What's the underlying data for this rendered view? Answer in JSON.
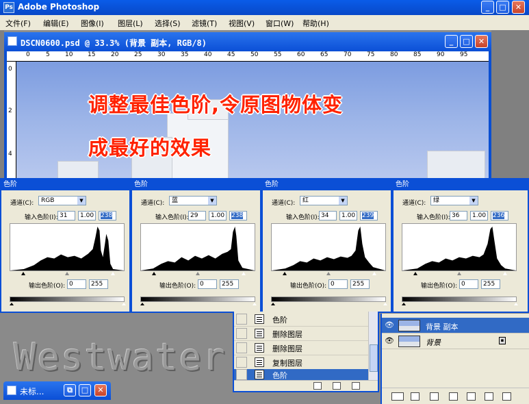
{
  "app": {
    "title": "Adobe Photoshop",
    "min": "_",
    "max": "□",
    "close": "✕"
  },
  "menu": [
    "文件(F)",
    "编辑(E)",
    "图像(I)",
    "图层(L)",
    "选择(S)",
    "滤镜(T)",
    "视图(V)",
    "窗口(W)",
    "帮助(H)"
  ],
  "document": {
    "title": "DSCN0600.psd @ 33.3% (背景 副本, RGB/8)",
    "ruler_top": [
      "0",
      "5",
      "10",
      "15",
      "20",
      "25",
      "30",
      "35",
      "40",
      "45",
      "50",
      "55",
      "60",
      "65",
      "70",
      "75",
      "80",
      "85",
      "90",
      "95"
    ],
    "ruler_left": [
      "0",
      "2",
      "4"
    ],
    "caption_line1": "调整最佳色阶,令原图物体变",
    "caption_line2": "成最好的效果"
  },
  "levels_dialogs": [
    {
      "title": "色阶",
      "channel_label": "通道(C):",
      "channel": "RGB",
      "input_label": "输入色阶(I):",
      "in_black": "31",
      "in_mid": "1.00",
      "in_white": "238",
      "output_label": "输出色阶(O):",
      "out_black": "0",
      "out_white": "255"
    },
    {
      "title": "色阶",
      "channel_label": "通道(C):",
      "channel": "蓝",
      "input_label": "输入色阶(I):",
      "in_black": "29",
      "in_mid": "1.00",
      "in_white": "238",
      "output_label": "输出色阶(O):",
      "out_black": "0",
      "out_white": "255"
    },
    {
      "title": "色阶",
      "channel_label": "通道(C):",
      "channel": "红",
      "input_label": "输入色阶(I):",
      "in_black": "34",
      "in_mid": "1.00",
      "in_white": "239",
      "output_label": "输出色阶(O):",
      "out_black": "0",
      "out_white": "255"
    },
    {
      "title": "色阶",
      "channel_label": "通道(C):",
      "channel": "绿",
      "input_label": "输入色阶(I):",
      "in_black": "36",
      "in_mid": "1.00",
      "in_white": "236",
      "output_label": "输出色阶(O):",
      "out_black": "0",
      "out_white": "255"
    }
  ],
  "watermark": "Westwater",
  "history": {
    "items": [
      {
        "label": "色阶",
        "active": false
      },
      {
        "label": "删除图层",
        "active": false
      },
      {
        "label": "删除图层",
        "active": false
      },
      {
        "label": "复制图层",
        "active": false
      },
      {
        "label": "色阶",
        "active": true
      }
    ]
  },
  "layers": {
    "items": [
      {
        "label": "背景 副本",
        "active": true,
        "locked": false
      },
      {
        "label": "背景",
        "active": false,
        "locked": true
      }
    ]
  },
  "minimized_window": {
    "title": "未标...",
    "restore": "⧉",
    "max": "□",
    "close": "✕"
  },
  "colors": {
    "titlebar": "#0b4fd6",
    "caption_red": "#ff2200",
    "selection": "#316ac5"
  }
}
